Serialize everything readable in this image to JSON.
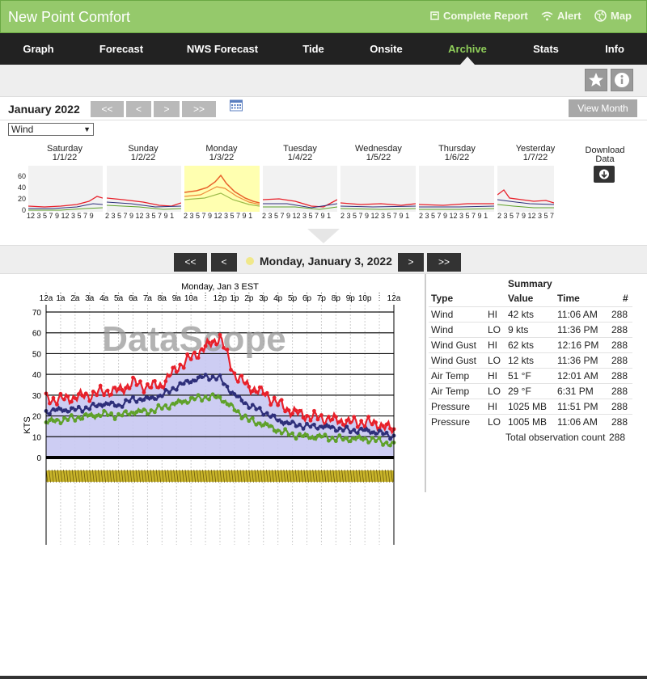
{
  "header": {
    "title": "New Point Comfort",
    "links": [
      {
        "label": "Complete Report",
        "icon": "report-icon"
      },
      {
        "label": "Alert",
        "icon": "wifi-icon"
      },
      {
        "label": "Map",
        "icon": "globe-icon"
      }
    ]
  },
  "nav": {
    "tabs": [
      "Graph",
      "Forecast",
      "NWS Forecast",
      "Tide",
      "Onsite",
      "Archive",
      "Stats",
      "Info"
    ],
    "active": "Archive"
  },
  "toolbar": {
    "star_icon": "star-icon",
    "info_icon": "info-icon"
  },
  "month_bar": {
    "title": "January 2022",
    "buttons": [
      "<<",
      "<",
      ">",
      ">>"
    ],
    "calendar_icon": "calendar-icon",
    "view_month_label": "View Month"
  },
  "variable_select": {
    "value": "Wind"
  },
  "week": {
    "days": [
      {
        "name": "Saturday",
        "date": "1/1/22",
        "axis": "12 3 5 7 9 12 3 5 7 9"
      },
      {
        "name": "Sunday",
        "date": "1/2/22",
        "axis": "2 3 5 7 9 12 3 5 7 9 1"
      },
      {
        "name": "Monday",
        "date": "1/3/22",
        "axis": "2 3 5 7 9 12 3 5 7 9 1"
      },
      {
        "name": "Tuesday",
        "date": "1/4/22",
        "axis": "2 3 5 7 9 12 3 5 7 9 1"
      },
      {
        "name": "Wednesday",
        "date": "1/5/22",
        "axis": "2 3 5 7 9 12 3 5 7 9 1"
      },
      {
        "name": "Thursday",
        "date": "1/6/22",
        "axis": "2 3 5 7 9 12 3 5 7 9 1"
      },
      {
        "name": "Yesterday",
        "date": "1/7/22",
        "axis": "2 3 5 7 9 12 3 5 7 9"
      }
    ],
    "yticks": [
      "60",
      "40",
      "20",
      "0"
    ],
    "download_label": "Download Data"
  },
  "day_nav": {
    "buttons": [
      "<<",
      "<",
      ">",
      ">>"
    ],
    "title": "Monday, January 3, 2022"
  },
  "summary": {
    "title": "Summary",
    "headers": [
      "Type",
      "Value",
      "Time",
      "#"
    ],
    "rows": [
      [
        "Wind",
        "HI",
        "42 kts",
        "11:06 AM",
        "288"
      ],
      [
        "Wind",
        "LO",
        "9 kts",
        "11:36 PM",
        "288"
      ],
      [
        "Wind Gust",
        "HI",
        "62 kts",
        "12:16 PM",
        "288"
      ],
      [
        "Wind Gust",
        "LO",
        "12 kts",
        "11:36 PM",
        "288"
      ],
      [
        "Air Temp",
        "HI",
        "51 °F",
        "12:01 AM",
        "288"
      ],
      [
        "Air Temp",
        "LO",
        "29 °F",
        "6:31 PM",
        "288"
      ],
      [
        "Pressure",
        "HI",
        "1025 MB",
        "11:51 PM",
        "288"
      ],
      [
        "Pressure",
        "LO",
        "1005 MB",
        "11:06 AM",
        "288"
      ]
    ],
    "total_label": "Total observation count",
    "total_value": "288"
  },
  "colors": {
    "header": "#95c96b",
    "nav": "#222222",
    "active_tab": "#8fce5a",
    "gust": "#e8202a",
    "wind": "#2e2f7a",
    "lull": "#5fa12a",
    "band": "#c8c8f2",
    "dir": "#c9b52a"
  },
  "chart_data": {
    "type": "line",
    "title": "Monday, Jan 3 EST",
    "watermark": "DataScope",
    "ylabel": "KTS",
    "ylim": [
      0,
      70
    ],
    "yticks": [
      0,
      10,
      20,
      30,
      40,
      50,
      60,
      70
    ],
    "xtick_labels": [
      "12a",
      "1a",
      "2a",
      "3a",
      "4a",
      "5a",
      "6a",
      "7a",
      "8a",
      "9a",
      "10a",
      "",
      "12p",
      "1p",
      "2p",
      "3p",
      "4p",
      "5p",
      "6p",
      "7p",
      "8p",
      "9p",
      "10p",
      "",
      "12a"
    ],
    "x_hours": [
      0,
      1,
      2,
      3,
      4,
      5,
      6,
      7,
      8,
      9,
      10,
      11,
      12,
      13,
      14,
      15,
      16,
      17,
      18,
      19,
      20,
      21,
      22,
      23,
      24
    ],
    "series": [
      {
        "values": [
          28,
          28,
          29,
          30,
          32,
          32,
          36,
          34,
          35,
          43,
          48,
          53,
          58,
          40,
          34,
          31,
          26,
          22,
          20,
          19,
          18,
          17,
          17,
          16,
          13
        ]
      },
      {
        "values": [
          22,
          23,
          23,
          24,
          26,
          25,
          28,
          28,
          30,
          34,
          37,
          39,
          38,
          30,
          25,
          22,
          18,
          16,
          15,
          15,
          14,
          13,
          13,
          12,
          10
        ]
      },
      {
        "values": [
          17,
          18,
          19,
          20,
          21,
          20,
          22,
          22,
          24,
          26,
          28,
          29,
          29,
          23,
          18,
          16,
          13,
          11,
          10,
          10,
          9,
          9,
          9,
          8,
          6
        ]
      }
    ]
  }
}
